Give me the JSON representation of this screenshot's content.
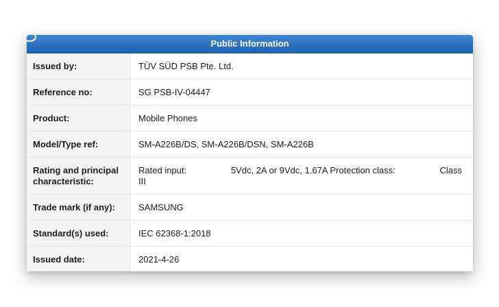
{
  "header": {
    "title": "Public Information"
  },
  "rows": [
    {
      "label": "Issued by:",
      "value": "TÜV SÜD PSB Pte. Ltd."
    },
    {
      "label": "Reference no:",
      "value": "SG PSB-IV-04447"
    },
    {
      "label": "Product:",
      "value": "Mobile Phones"
    },
    {
      "label": "Model/Type ref:",
      "value": "SM-A226B/DS, SM-A226B/DSN, SM-A226B"
    },
    {
      "label": "Rating and principal characteristic:",
      "value": {
        "part1": "Rated input:",
        "part2": "5Vdc, 2A or 9Vdc, 1.67A Protection class:",
        "part3": "Class",
        "part4": "III"
      }
    },
    {
      "label": "Trade mark (if any):",
      "value": "SAMSUNG"
    },
    {
      "label": "Standard(s) used:",
      "value": "IEC 62368-1:2018"
    },
    {
      "label": "Issued date:",
      "value": "2021-4-26"
    }
  ],
  "colors": {
    "header_top": "#3f86d2",
    "header_bottom": "#1f63b4",
    "label_bg": "#f3f3f3",
    "border": "#e4e4e4"
  }
}
